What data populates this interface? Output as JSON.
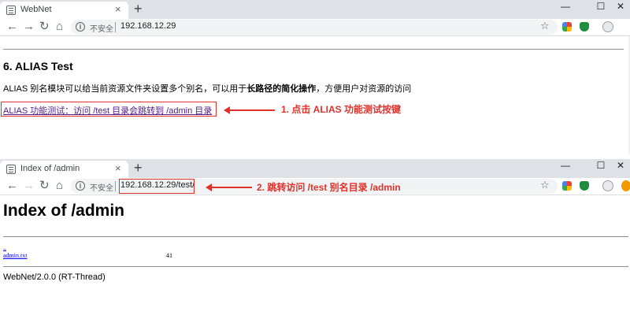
{
  "window1": {
    "tab_title": "WebNet",
    "tab_close": "×",
    "new_tab": "+",
    "controls": {
      "minimize": "—",
      "maximize": "☐",
      "close": "✕"
    },
    "nav": {
      "back": "←",
      "forward": "→",
      "reload": "↻",
      "home": "⌂"
    },
    "security_text": "不安全",
    "url": "192.168.12.29",
    "star": "☆",
    "content": {
      "heading": "6. ALIAS Test",
      "desc_pre": "ALIAS 别名模块可以给当前资源文件夹设置多个别名，可以用于",
      "desc_bold": "长路径的简化操作",
      "desc_post": "，方便用户对资源的访问",
      "link": "ALIAS 功能测试：访问 /test 目录会跳转到 /admin 目录",
      "annotation": "1. 点击 ALIAS 功能测试按键"
    }
  },
  "window2": {
    "tab_title": "Index of /admin",
    "tab_close": "×",
    "new_tab": "+",
    "controls": {
      "minimize": "—",
      "maximize": "☐",
      "close": "✕"
    },
    "nav": {
      "back": "←",
      "forward": "→",
      "reload": "↻",
      "home": "⌂"
    },
    "security_text": "不安全",
    "url": "192.168.12.29/test/",
    "star": "☆",
    "annotation": "2.  跳转访问 /test 别名目录 /admin",
    "content": {
      "heading": "Index of /admin",
      "entries": [
        {
          "name": "..",
          "size": ""
        },
        {
          "name": "admin.txt",
          "size": "41"
        }
      ],
      "footer": "WebNet/2.0.0 (RT-Thread)"
    }
  },
  "colors": {
    "annotation": "#e0322b",
    "visited_link": "#551a8b",
    "link": "#0000ee",
    "tabstrip": "#dee1e6"
  },
  "icons": [
    "info-icon",
    "star-icon",
    "google-ext-icon",
    "shield-ext-icon",
    "avatar-icon",
    "favicon-icon"
  ]
}
